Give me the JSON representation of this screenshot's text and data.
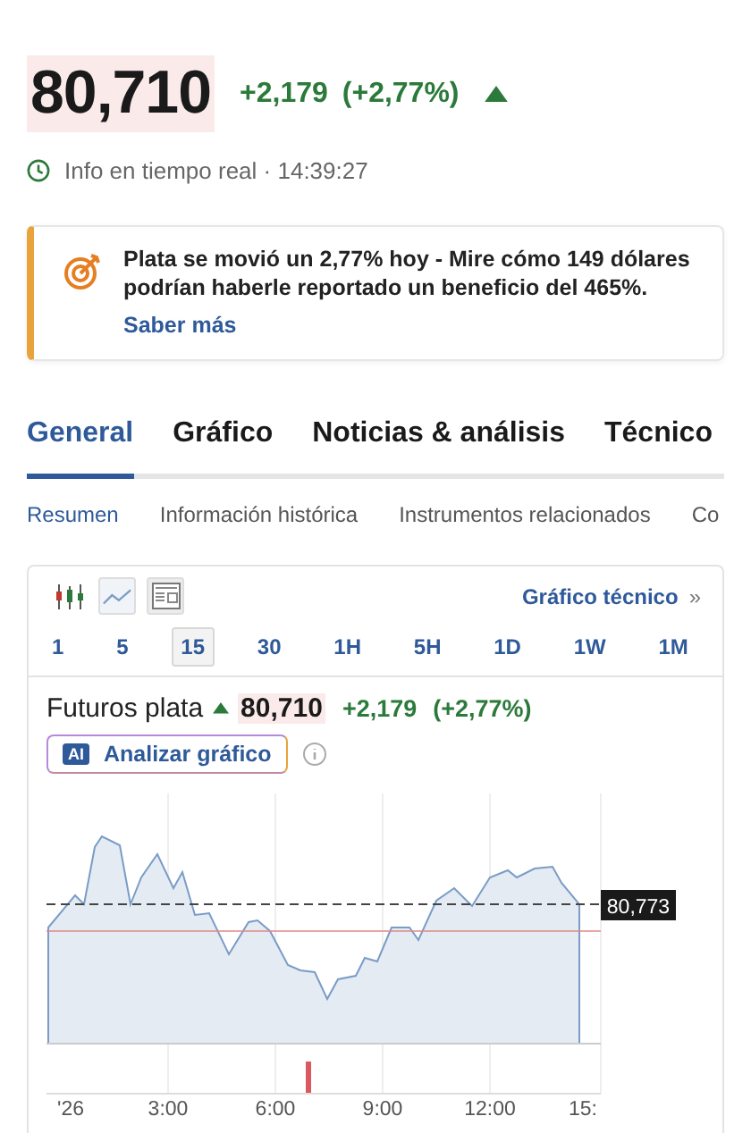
{
  "quote": {
    "price": "80,710",
    "change": "+2,179",
    "change_percent": "(+2,77%)"
  },
  "status": {
    "text": "Info en tiempo real · 14:39:27"
  },
  "promo": {
    "text": "Plata se movió un 2,77% hoy - Mire cómo 149 dólares podrían haberle reportado un beneficio del 465%.",
    "link": "Saber más"
  },
  "tabs": [
    {
      "label": "General",
      "selected": true
    },
    {
      "label": "Gráfico",
      "selected": false
    },
    {
      "label": "Noticias & análisis",
      "selected": false
    },
    {
      "label": "Técnico",
      "selected": false
    }
  ],
  "subtabs": [
    {
      "label": "Resumen",
      "selected": true
    },
    {
      "label": "Información histórica",
      "selected": false
    },
    {
      "label": "Instrumentos relacionados",
      "selected": false
    },
    {
      "label": "Co",
      "selected": false
    }
  ],
  "chart_widget": {
    "chart_types": [
      {
        "kind": "candles"
      },
      {
        "kind": "area"
      },
      {
        "kind": "layout"
      }
    ],
    "link": "Gráfico técnico",
    "link_icon": "»",
    "intervals": [
      {
        "label": "1",
        "selected": false
      },
      {
        "label": "5",
        "selected": false
      },
      {
        "label": "15",
        "selected": true
      },
      {
        "label": "30",
        "selected": false
      },
      {
        "label": "1H",
        "selected": false
      },
      {
        "label": "5H",
        "selected": false
      },
      {
        "label": "1D",
        "selected": false
      },
      {
        "label": "1W",
        "selected": false
      },
      {
        "label": "1M",
        "selected": false
      }
    ],
    "instrument": {
      "name": "Futuros plata",
      "price": "80,710",
      "change": "+2,179",
      "change_percent": "(+2,77%)"
    },
    "analyze_button": {
      "badge": "AI",
      "label": "Analizar gráfico"
    },
    "last_price": "80,773",
    "x_labels": [
      "'26",
      "3:00",
      "6:00",
      "9:00",
      "12:00",
      "15:"
    ]
  }
}
